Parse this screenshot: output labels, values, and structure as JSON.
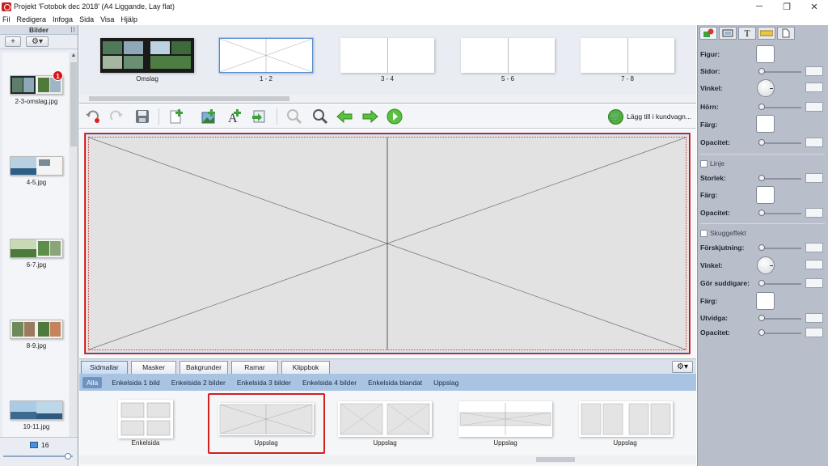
{
  "window": {
    "title": "Projekt 'Fotobok dec 2018' (A4 Liggande, Lay flat)",
    "controls": {
      "minimize": "─",
      "restore": "❐",
      "close": "✕"
    }
  },
  "menu": [
    "Fil",
    "Redigera",
    "Infoga",
    "Sida",
    "Visa",
    "Hjälp"
  ],
  "left_panel": {
    "header": "Bilder",
    "add_label": "+",
    "settings_label": "⚙▾",
    "photos": [
      {
        "caption": "2-3-omslag.jpg",
        "badge": "1"
      },
      {
        "caption": "4-5.jpg"
      },
      {
        "caption": "6-7.jpg"
      },
      {
        "caption": "8-9.jpg"
      },
      {
        "caption": "10-11.jpg"
      }
    ],
    "count": "16"
  },
  "page_strip": {
    "pages": [
      {
        "caption": "Omslag"
      },
      {
        "caption": "1 - 2",
        "selected": true
      },
      {
        "caption": "3 - 4"
      },
      {
        "caption": "5 - 6"
      },
      {
        "caption": "7 - 8"
      }
    ]
  },
  "toolbar": {
    "icons": [
      "undo-icon",
      "redo-icon",
      "save-icon",
      "add-page-icon",
      "add-image-icon",
      "add-text-icon",
      "import-icon",
      "zoom-out-icon",
      "zoom-in-icon",
      "arrow-left-icon",
      "arrow-right-icon",
      "play-icon"
    ],
    "cart_label": "Lägg till i kundvagn..."
  },
  "bottom_tabs": {
    "tabs": [
      "Sidmallar",
      "Masker",
      "Bakgrunder",
      "Ramar",
      "Klippbok"
    ],
    "active": "Sidmallar",
    "gear": "⚙▾"
  },
  "filters": [
    "Alla",
    "Enkelsida 1 bild",
    "Enkelsida 2 bilder",
    "Enkelsida 3 bilder",
    "Enkelsida 4 bilder",
    "Enkelsida blandat",
    "Uppslag"
  ],
  "templates": [
    {
      "caption": "Enkelsida"
    },
    {
      "caption": "Uppslag",
      "highlighted": true
    },
    {
      "caption": "Uppslag"
    },
    {
      "caption": "Uppslag"
    },
    {
      "caption": "Uppslag"
    }
  ],
  "right_panel": {
    "tabs": [
      "shape-icon",
      "frame-icon",
      "T",
      "ruler-icon",
      "page-icon"
    ],
    "figur": "Figur:",
    "sidor": "Sidor:",
    "vinkel": "Vinkel:",
    "horn": "Hörn:",
    "farg": "Färg:",
    "opacitet": "Opacitet:",
    "linje": "Linje",
    "storlek": "Storlek:",
    "farg2": "Färg:",
    "opacitet2": "Opacitet:",
    "skuggeffekt": "Skuggeffekt",
    "forskjutning": "Förskjutning:",
    "vinkel2": "Vinkel:",
    "gor_suddigare": "Gör suddigare:",
    "farg3": "Färg:",
    "utvidga": "Utvidga:",
    "opacitet3": "Opacitet:"
  },
  "colors": {
    "accent": "#a9c4e2",
    "highlight": "#d41f1f",
    "panel": "#b8bfcb"
  }
}
